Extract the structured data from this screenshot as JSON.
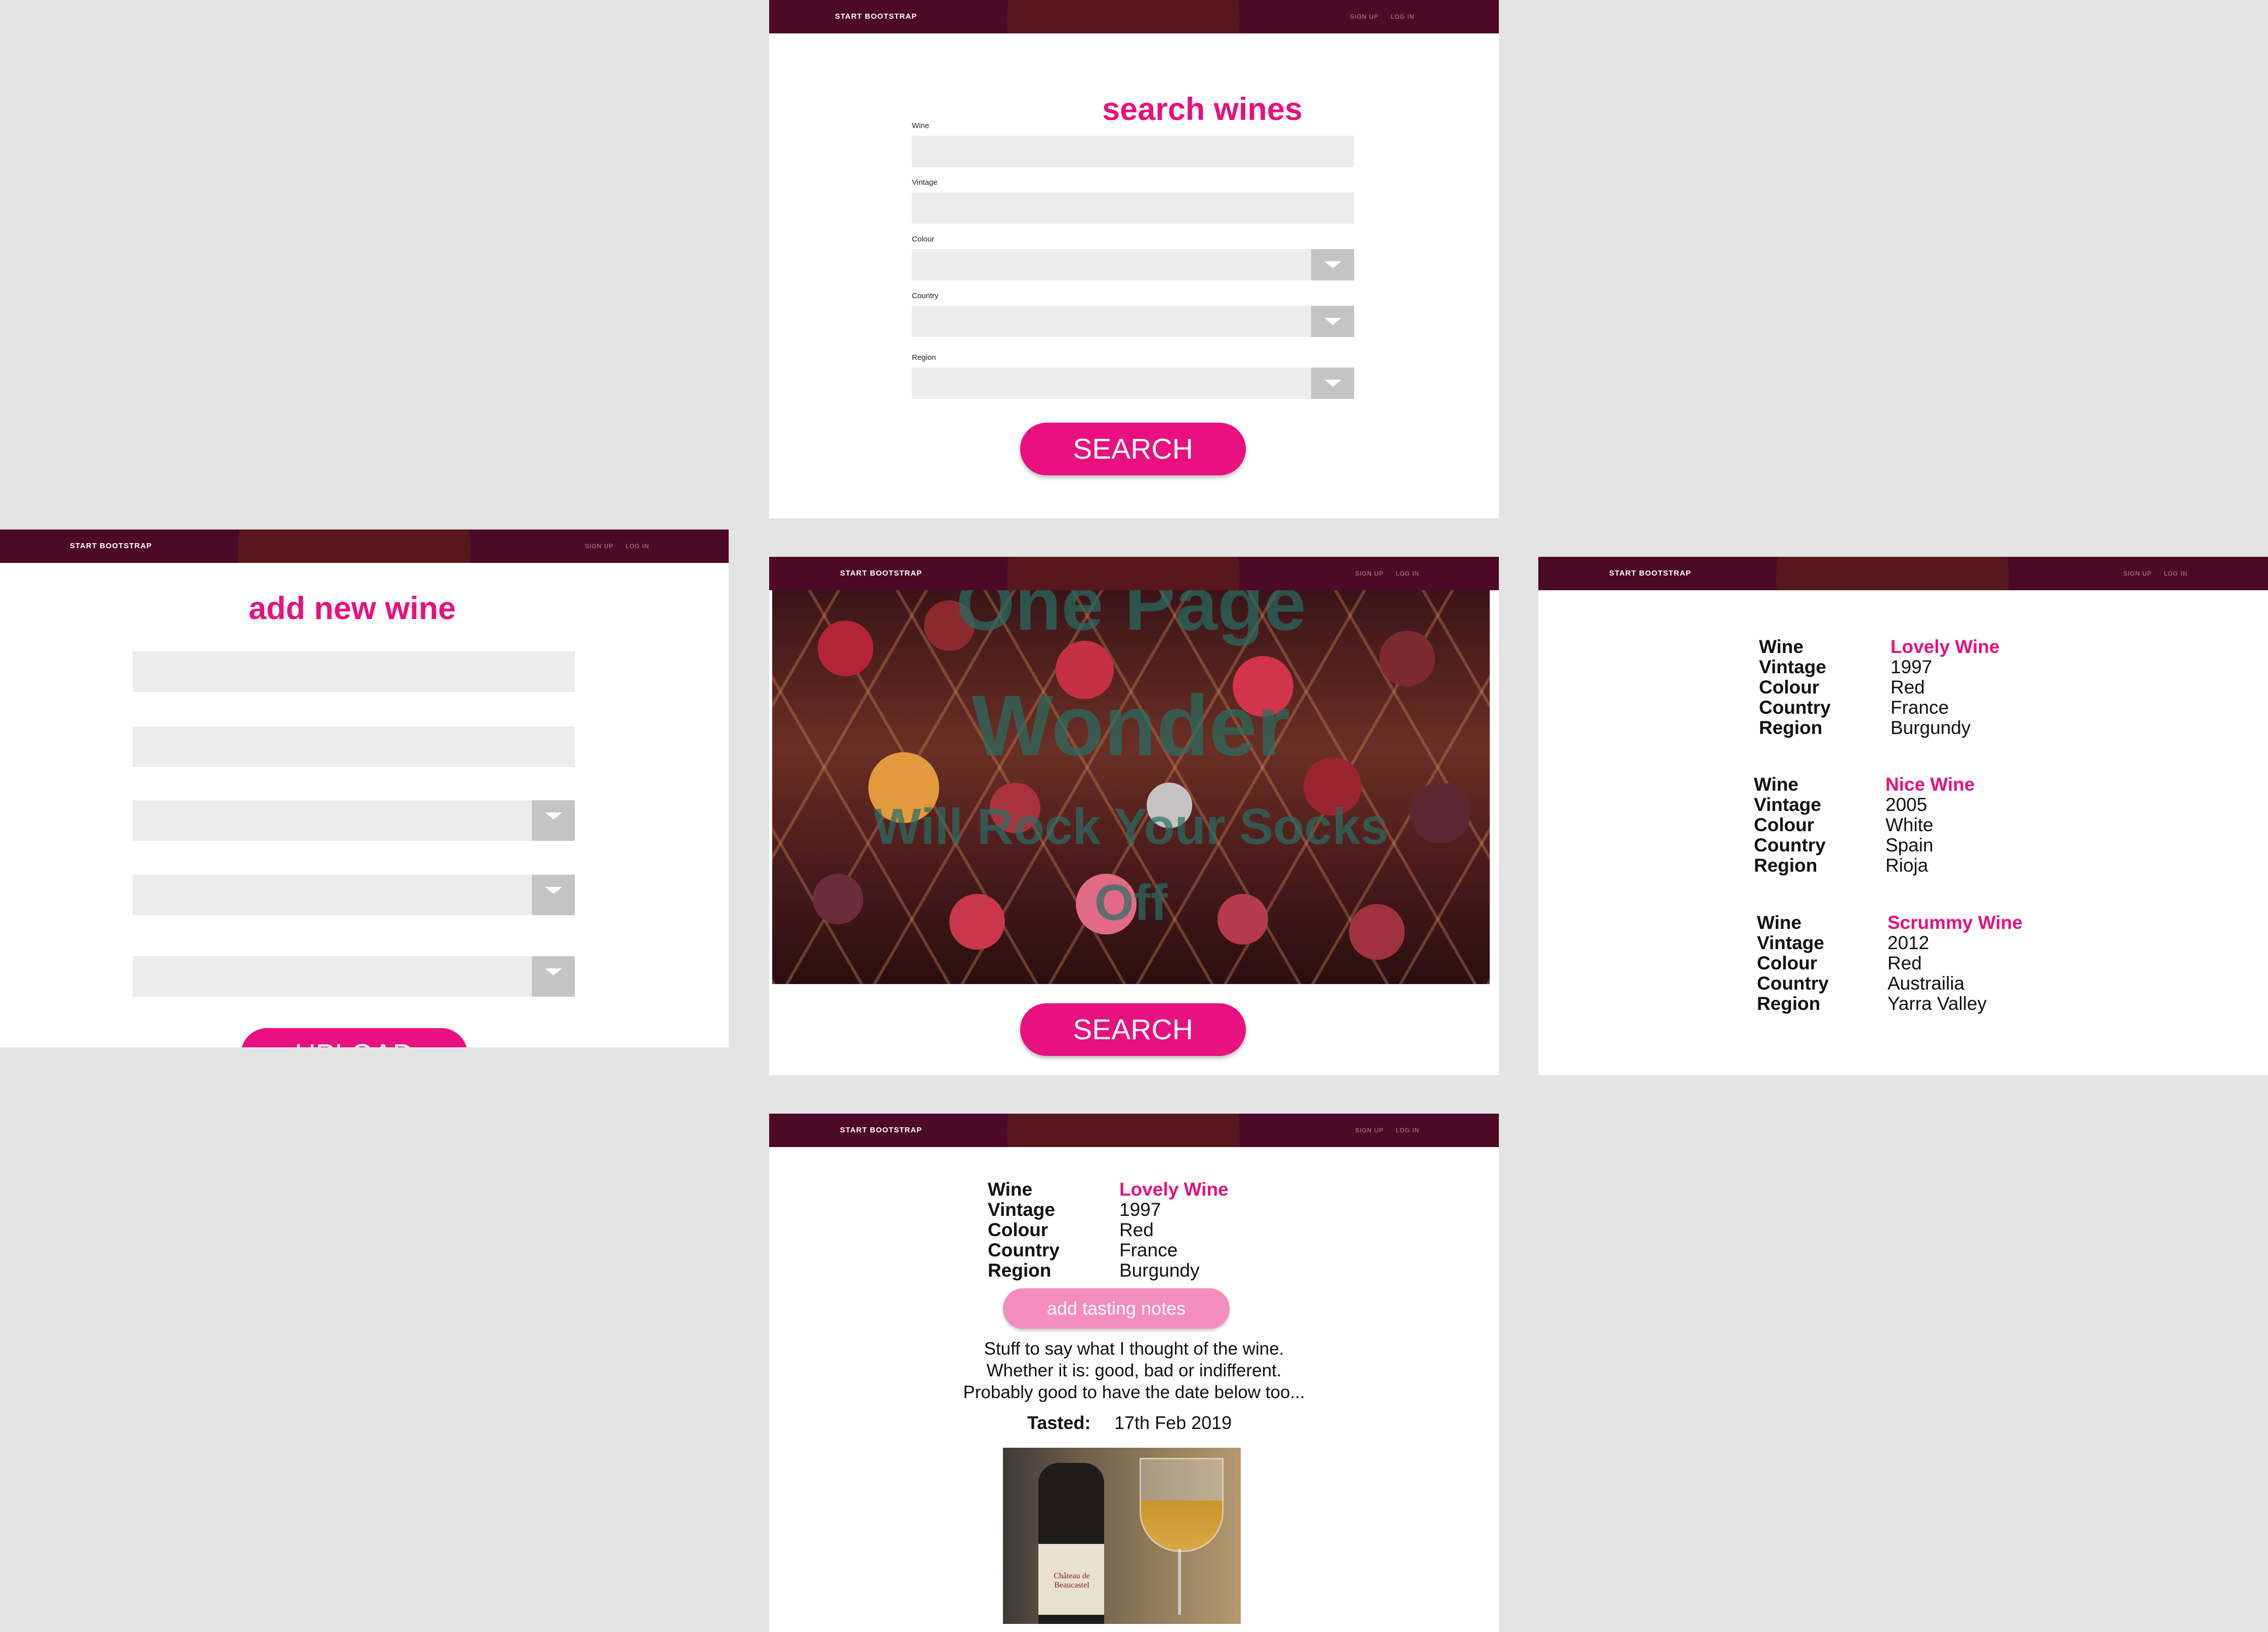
{
  "nav": {
    "brand": "START BOOTSTRAP",
    "signup": "SIGN UP",
    "login": "LOG IN"
  },
  "search_page": {
    "title": "search wines",
    "labels": [
      "Wine",
      "Vintage",
      "Colour",
      "Country",
      "Region"
    ],
    "button": "SEARCH"
  },
  "add_page": {
    "title": "add new wine",
    "button": "UPLOAD"
  },
  "hero_page": {
    "overlay_line1": "One Page",
    "overlay_line2": "Wonder",
    "overlay_line3": "Will Rock Your Socks",
    "overlay_line4": "Off",
    "button": "SEARCH"
  },
  "results_page": {
    "field_labels": [
      "Wine",
      "Vintage",
      "Colour",
      "Country",
      "Region"
    ],
    "wines": [
      {
        "name": "Lovely Wine",
        "vintage": "1997",
        "colour": "Red",
        "country": "France",
        "region": "Burgundy"
      },
      {
        "name": "Nice Wine",
        "vintage": "2005",
        "colour": "White",
        "country": "Spain",
        "region": "Rioja"
      },
      {
        "name": "Scrummy Wine",
        "vintage": "2012",
        "colour": "Red",
        "country": "Austrailia",
        "region": "Yarra Valley"
      }
    ]
  },
  "detail_page": {
    "wine": {
      "name": "Lovely Wine",
      "vintage": "1997",
      "colour": "Red",
      "country": "France",
      "region": "Burgundy"
    },
    "button": "add tasting notes",
    "notes": [
      "Stuff to say what I thought of the wine.",
      "Whether it is: good, bad or indifferent.",
      "Probably good to have the date below too..."
    ],
    "tasted_label": "Tasted:",
    "tasted_date": "17th Feb 2019",
    "photo_label": "Château de Beaucastel"
  },
  "colors": {
    "accent": "#e8117f",
    "navbar": "#4d0a27",
    "field": "#ececec",
    "background": "#e4e4e4"
  }
}
